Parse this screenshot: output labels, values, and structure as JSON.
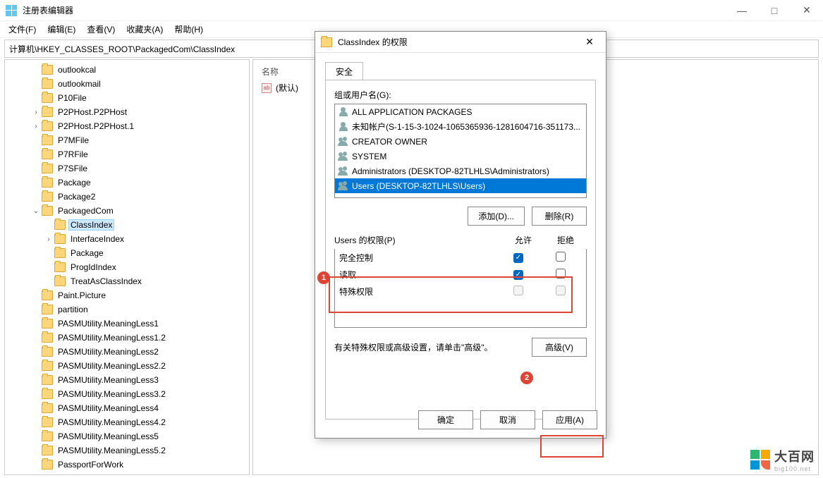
{
  "window": {
    "title": "注册表编辑器",
    "min": "—",
    "max": "□",
    "close": "✕"
  },
  "menu": {
    "file": "文件(F)",
    "edit": "编辑(E)",
    "view": "查看(V)",
    "fav": "收藏夹(A)",
    "help": "帮助(H)"
  },
  "path": "计算机\\HKEY_CLASSES_ROOT\\PackagedCom\\ClassIndex",
  "tree": [
    {
      "indent": 2,
      "exp": "",
      "label": "outlookcal"
    },
    {
      "indent": 2,
      "exp": "",
      "label": "outlookmail"
    },
    {
      "indent": 2,
      "exp": "",
      "label": "P10File"
    },
    {
      "indent": 2,
      "exp": ">",
      "label": "P2PHost.P2PHost"
    },
    {
      "indent": 2,
      "exp": ">",
      "label": "P2PHost.P2PHost.1"
    },
    {
      "indent": 2,
      "exp": "",
      "label": "P7MFile"
    },
    {
      "indent": 2,
      "exp": "",
      "label": "P7RFile"
    },
    {
      "indent": 2,
      "exp": "",
      "label": "P7SFile"
    },
    {
      "indent": 2,
      "exp": "",
      "label": "Package"
    },
    {
      "indent": 2,
      "exp": "",
      "label": "Package2"
    },
    {
      "indent": 2,
      "exp": "v",
      "label": "PackagedCom"
    },
    {
      "indent": 3,
      "exp": "",
      "label": "ClassIndex",
      "sel": true
    },
    {
      "indent": 3,
      "exp": ">",
      "label": "InterfaceIndex"
    },
    {
      "indent": 3,
      "exp": "",
      "label": "Package"
    },
    {
      "indent": 3,
      "exp": "",
      "label": "ProgIdIndex"
    },
    {
      "indent": 3,
      "exp": "",
      "label": "TreatAsClassIndex"
    },
    {
      "indent": 2,
      "exp": "",
      "label": "Paint.Picture"
    },
    {
      "indent": 2,
      "exp": "",
      "label": "partition"
    },
    {
      "indent": 2,
      "exp": "",
      "label": "PASMUtility.MeaningLess1"
    },
    {
      "indent": 2,
      "exp": "",
      "label": "PASMUtility.MeaningLess1.2"
    },
    {
      "indent": 2,
      "exp": "",
      "label": "PASMUtility.MeaningLess2"
    },
    {
      "indent": 2,
      "exp": "",
      "label": "PASMUtility.MeaningLess2.2"
    },
    {
      "indent": 2,
      "exp": "",
      "label": "PASMUtility.MeaningLess3"
    },
    {
      "indent": 2,
      "exp": "",
      "label": "PASMUtility.MeaningLess3.2"
    },
    {
      "indent": 2,
      "exp": "",
      "label": "PASMUtility.MeaningLess4"
    },
    {
      "indent": 2,
      "exp": "",
      "label": "PASMUtility.MeaningLess4.2"
    },
    {
      "indent": 2,
      "exp": "",
      "label": "PASMUtility.MeaningLess5"
    },
    {
      "indent": 2,
      "exp": "",
      "label": "PASMUtility.MeaningLess5.2"
    },
    {
      "indent": 2,
      "exp": "",
      "label": "PassportForWork"
    }
  ],
  "values": {
    "h_name": "名称",
    "default_name": "(默认)",
    "icon_text": "ab"
  },
  "dialog": {
    "title": "ClassIndex 的权限",
    "close": "✕",
    "tab": "安全",
    "group_label": "组或用户名(G):",
    "users": [
      {
        "icon": "single",
        "label": "ALL APPLICATION PACKAGES"
      },
      {
        "icon": "single",
        "label": "未知帐户(S-1-15-3-1024-1065365936-1281604716-351173..."
      },
      {
        "icon": "group",
        "label": "CREATOR OWNER"
      },
      {
        "icon": "group",
        "label": "SYSTEM"
      },
      {
        "icon": "group",
        "label": "Administrators (DESKTOP-82TLHLS\\Administrators)"
      },
      {
        "icon": "group",
        "label": "Users (DESKTOP-82TLHLS\\Users)",
        "sel": true
      }
    ],
    "add_btn": "添加(D)...",
    "remove_btn": "删除(R)",
    "perm_label": "Users 的权限(P)",
    "col_allow": "允许",
    "col_deny": "拒绝",
    "perms": [
      {
        "name": "完全控制",
        "allow": true,
        "deny": false
      },
      {
        "name": "读取",
        "allow": true,
        "deny": false
      },
      {
        "name": "特殊权限",
        "allow": false,
        "deny": false,
        "disabled": true
      }
    ],
    "adv_text": "有关特殊权限或高级设置，请单击\"高级\"。",
    "adv_btn": "高级(V)",
    "ok": "确定",
    "cancel": "取消",
    "apply": "应用(A)"
  },
  "markers": {
    "m1": "1",
    "m2": "2"
  },
  "watermark": {
    "main": "大百网",
    "sub": "big100.net"
  }
}
